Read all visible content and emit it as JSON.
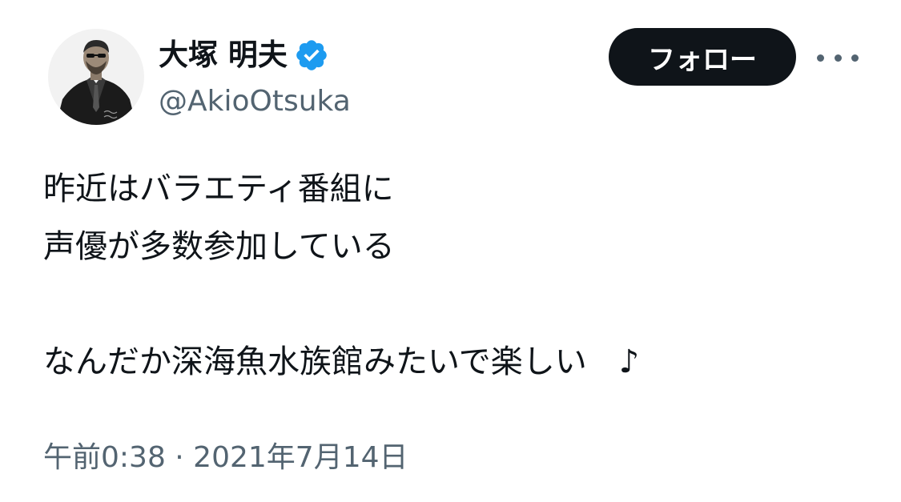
{
  "profile": {
    "display_name": "大塚 明夫",
    "handle": "@AkioOtsuka",
    "avatar_icon": "profile-photo",
    "verified_icon": "verified-badge-icon",
    "verified_color": "#1d9bf0"
  },
  "actions": {
    "follow_label": "フォロー",
    "more_icon": "more-options-icon"
  },
  "tweet": {
    "lines": [
      "昨近はバラエティ番組に",
      "声優が多数参加している",
      "",
      "なんだか深海魚水族館みたいで楽しい　♪"
    ],
    "timestamp": "午前0:38 · 2021年7月14日"
  },
  "colors": {
    "text_primary": "#0f1419",
    "text_secondary": "#536471",
    "button_bg": "#0f1419",
    "button_text": "#ffffff"
  }
}
